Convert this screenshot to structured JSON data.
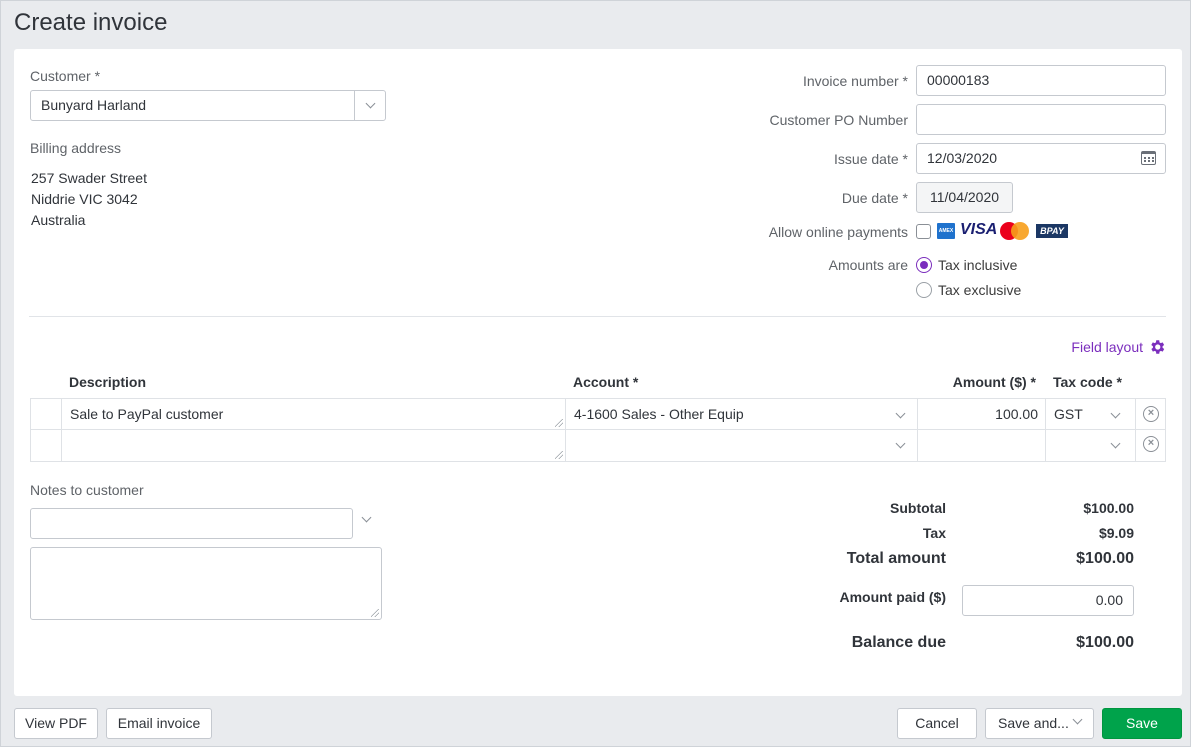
{
  "page": {
    "title": "Create invoice"
  },
  "customer": {
    "label": "Customer",
    "value": "Bunyard Harland"
  },
  "billing": {
    "label": "Billing address",
    "lines": [
      "257 Swader Street",
      "Niddrie VIC 3042",
      "Australia"
    ]
  },
  "invoice_number": {
    "label": "Invoice number",
    "value": "00000183"
  },
  "customer_po": {
    "label": "Customer PO Number",
    "value": ""
  },
  "issue_date": {
    "label": "Issue date",
    "value": "12/03/2020"
  },
  "due_date": {
    "label": "Due date",
    "value": "11/04/2020"
  },
  "online_payments": {
    "label": "Allow online payments",
    "checked": false,
    "logos": [
      "AMEX",
      "VISA",
      "mastercard",
      "BPAY"
    ]
  },
  "amounts_are": {
    "label": "Amounts are",
    "options": [
      "Tax inclusive",
      "Tax exclusive"
    ],
    "selected": "Tax inclusive"
  },
  "field_layout": {
    "label": "Field layout",
    "icon": "gear-icon",
    "color": "#7b2ebd"
  },
  "table": {
    "headers": {
      "description": "Description",
      "account": "Account",
      "amount": "Amount ($)",
      "tax_code": "Tax code"
    },
    "rows": [
      {
        "description": "Sale to PayPal customer",
        "account": "4-1600 Sales - Other Equip",
        "amount": "100.00",
        "tax_code": "GST"
      },
      {
        "description": "",
        "account": "",
        "amount": "",
        "tax_code": ""
      }
    ]
  },
  "notes": {
    "label": "Notes to customer",
    "select_value": "",
    "text": ""
  },
  "totals": {
    "subtotal_label": "Subtotal",
    "subtotal": "$100.00",
    "tax_label": "Tax",
    "tax": "$9.09",
    "total_label": "Total amount",
    "total": "$100.00",
    "paid_label": "Amount paid ($)",
    "paid": "0.00",
    "balance_label": "Balance due",
    "balance": "$100.00"
  },
  "footer": {
    "view_pdf": "View PDF",
    "email_invoice": "Email invoice",
    "cancel": "Cancel",
    "save_and": "Save and...",
    "save": "Save"
  },
  "colors": {
    "accent": "#7b2ebd",
    "save": "#00a34b",
    "background": "#e9ebee"
  }
}
